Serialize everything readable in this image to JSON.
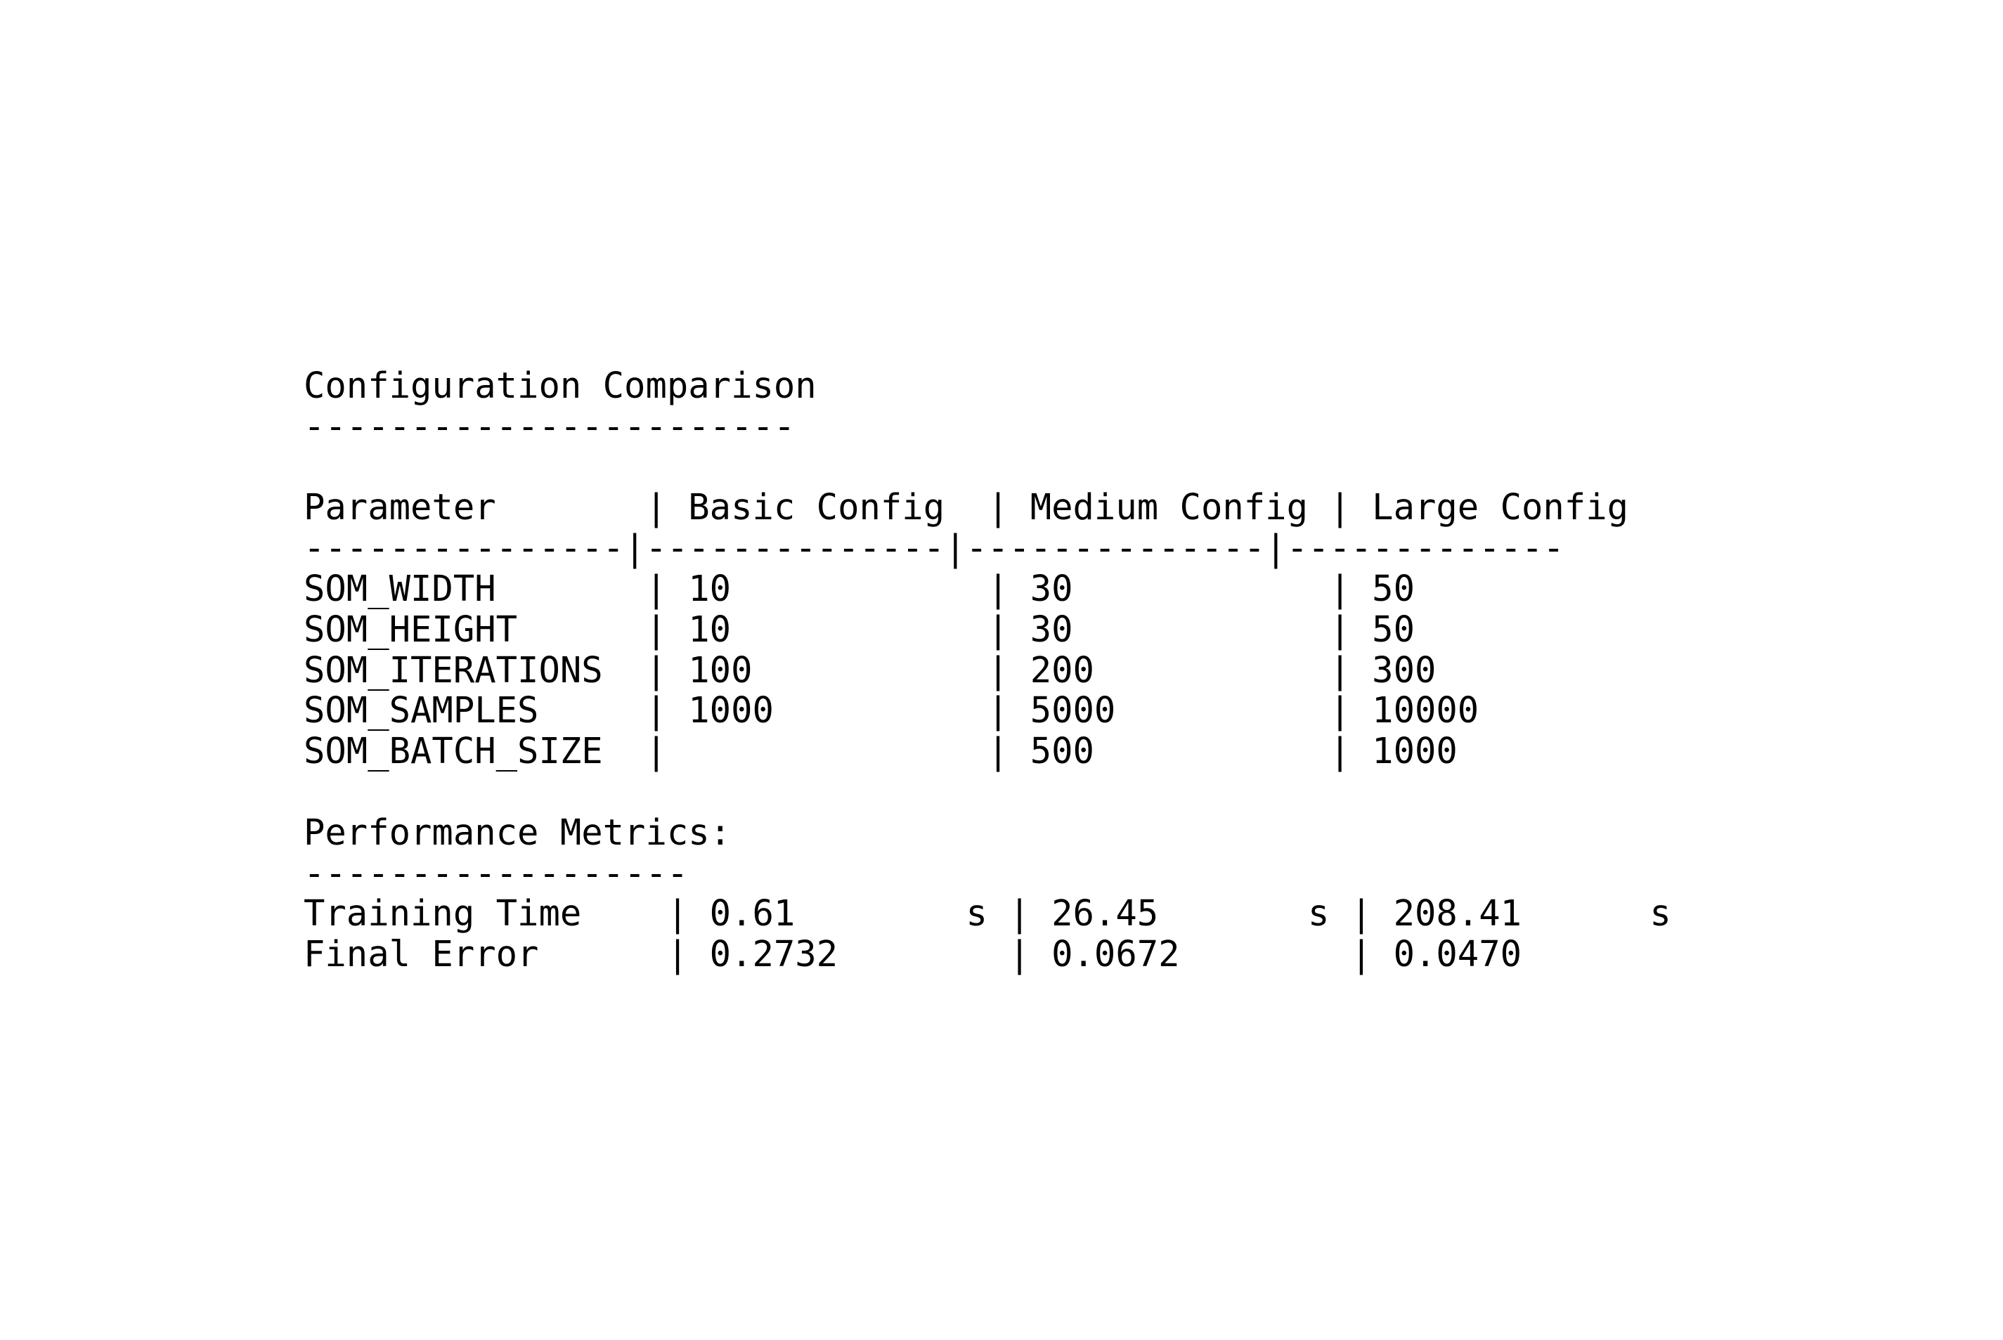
{
  "document": {
    "lines": [
      "Configuration Comparison",
      "-----------------------",
      "",
      "Parameter       | Basic Config  | Medium Config | Large Config",
      "---------------|--------------|--------------|-------------",
      "SOM_WIDTH       | 10            | 30            | 50",
      "SOM_HEIGHT      | 10            | 30            | 50",
      "SOM_ITERATIONS  | 100           | 200           | 300",
      "SOM_SAMPLES     | 1000          | 5000          | 10000",
      "SOM_BATCH_SIZE  |               | 500           | 1000",
      "",
      "Performance Metrics:",
      "------------------",
      "Training Time    | 0.61        s | 26.45       s | 208.41      s",
      "Final Error      | 0.2732        | 0.0672        | 0.0470"
    ]
  }
}
